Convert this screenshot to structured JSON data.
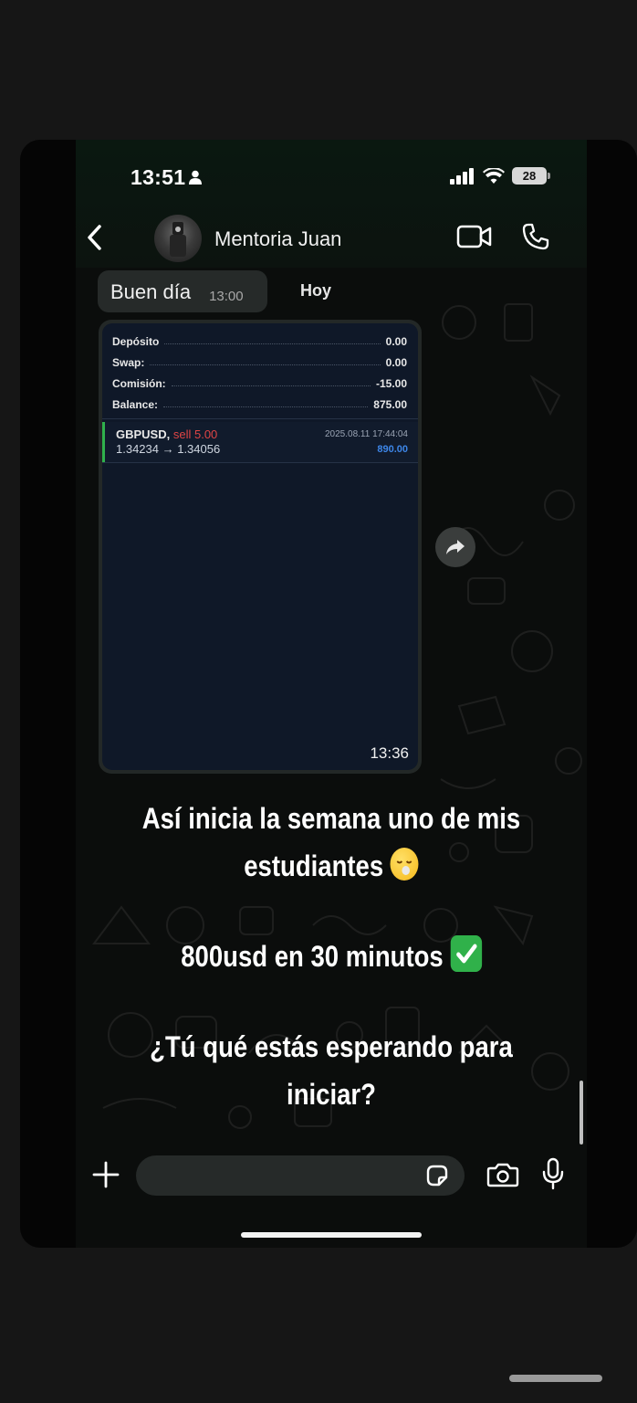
{
  "status_bar": {
    "time": "13:51",
    "battery": "28"
  },
  "chat_header": {
    "contact_name": "Mentoria Juan"
  },
  "messages": {
    "incoming_text": "Buen día",
    "incoming_time": "13:00",
    "date_separator": "Hoy",
    "image_time": "13:36"
  },
  "account_summary": [
    {
      "label": "Depósito",
      "value": "0.00"
    },
    {
      "label": "Swap:",
      "value": "0.00"
    },
    {
      "label": "Comisión:",
      "value": "-15.00"
    },
    {
      "label": "Balance:",
      "value": "875.00"
    }
  ],
  "trade": {
    "symbol": "GBPUSD,",
    "side": "sell 5.00",
    "prices": "1.34234 → 1.34056",
    "datetime": "2025.08.11 17:44:04",
    "profit": "890.00"
  },
  "overlay": {
    "line1": "Así inicia la semana uno de mis",
    "line2": "estudiantes",
    "line3": "800usd en 30 minutos",
    "line4": "¿Tú qué estás esperando para",
    "line5": "iniciar?"
  },
  "icons": [
    "person-icon",
    "signal-icon",
    "wifi-icon",
    "battery-icon",
    "back-chevron-icon",
    "video-call-icon",
    "phone-call-icon",
    "forward-icon",
    "plus-icon",
    "sticker-icon",
    "camera-icon",
    "microphone-icon"
  ],
  "colors": {
    "trade_side": "#e04545",
    "profit": "#3d86e8",
    "trade_accent": "#2fb14c"
  }
}
